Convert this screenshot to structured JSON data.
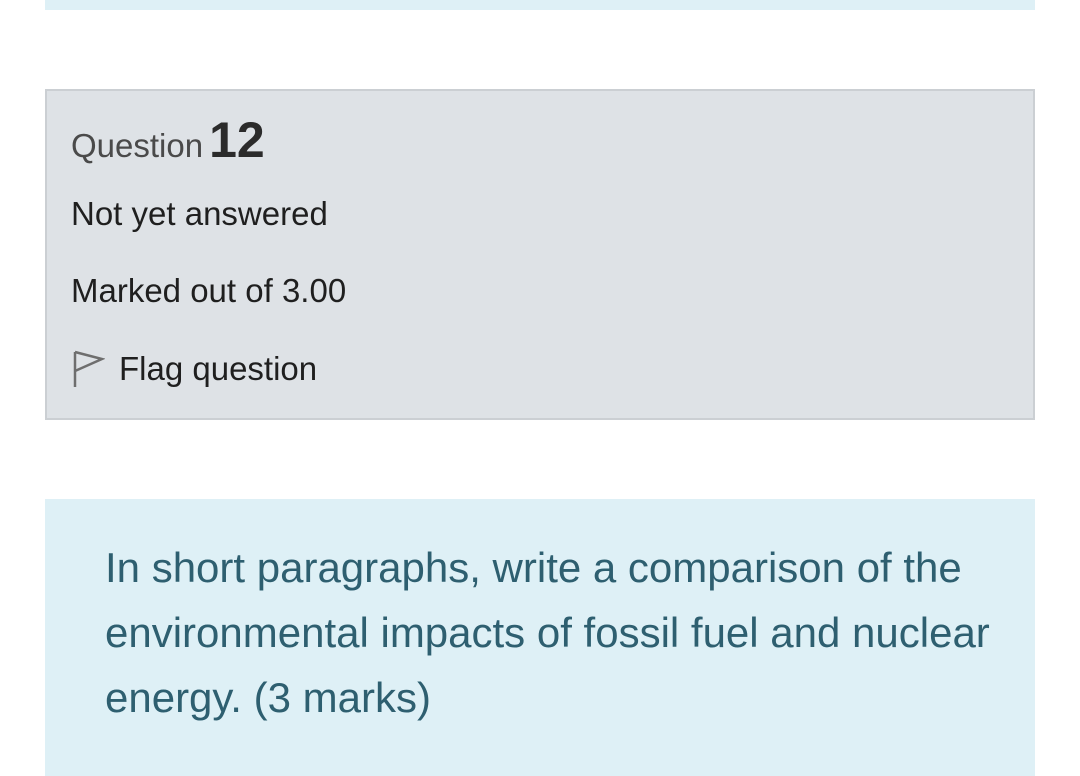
{
  "question": {
    "label": "Question",
    "number": "12",
    "state": "Not yet answered",
    "grade": "Marked out of 3.00",
    "flag_label": "Flag question",
    "flag_icon": "flag-icon",
    "text": "In short paragraphs, write a comparison of the environmental impacts of fossil fuel and nuclear energy.  (3 marks)"
  },
  "colors": {
    "info_background": "#dee2e6",
    "question_text_background": "#def0f6",
    "question_text_color": "#2e5f70"
  }
}
